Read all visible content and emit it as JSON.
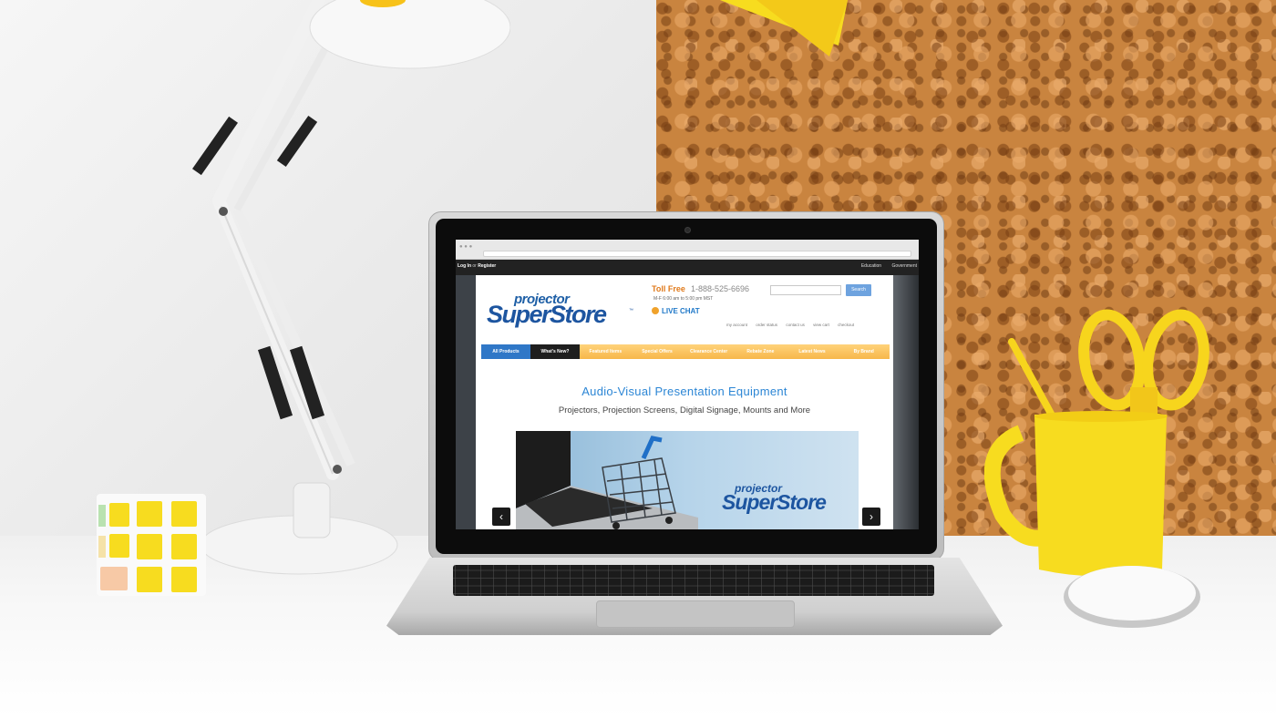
{
  "browser": {
    "topnav_left": [
      "Log In",
      "or",
      "Register"
    ],
    "topnav_right": [
      "Education",
      "Government"
    ]
  },
  "site": {
    "logo_small": "projector",
    "logo_big": "SuperStore",
    "logo_tm": "™",
    "toll_free_label": "Toll Free",
    "phone": "1-888-525-6696",
    "hours": "M-F 6:00 am to 5:00 pm MST",
    "live_chat": "LIVE CHAT",
    "search_placeholder": "",
    "search_button": "Search",
    "account_links": [
      "my account",
      "order status",
      "contact us",
      "view cart",
      "checkout"
    ],
    "menu": [
      "All Products",
      "What's New?",
      "Featured Items",
      "Special Offers",
      "Clearance Center",
      "Rebate Zone",
      "Latest News",
      "By Brand"
    ],
    "headline": "Audio-Visual Presentation Equipment",
    "subline": "Projectors, Projection Screens, Digital Signage, Mounts and More",
    "banner_logo_small": "projector",
    "banner_logo_big": "SuperStore",
    "prev_arrow": "‹",
    "next_arrow": "›"
  },
  "colors": {
    "brand_blue": "#1d55a0",
    "accent_orange": "#e07a1b",
    "menu_yellow": "#f7b74a",
    "cork": "#c9843f",
    "yellow": "#f7dc1f"
  }
}
